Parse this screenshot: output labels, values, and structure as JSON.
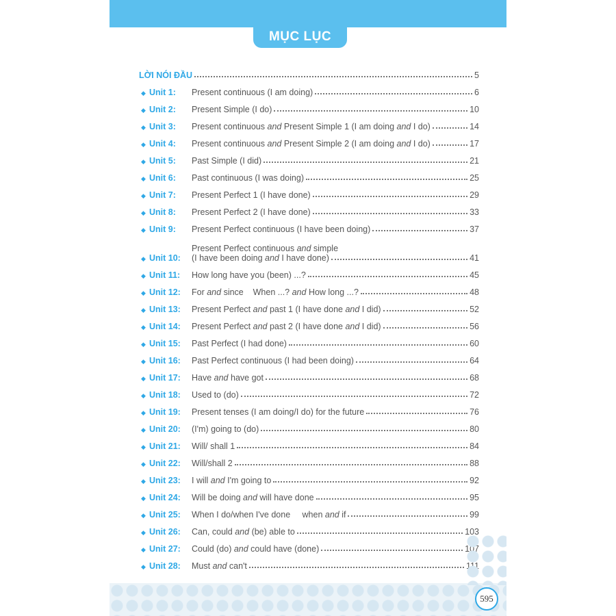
{
  "header": {
    "title": "MỤC LỤC"
  },
  "intro": {
    "label": "LỜI NÓI ĐẦU",
    "page": "5"
  },
  "units": [
    {
      "label": "Unit 1:",
      "title": "Present continuous (I am doing)",
      "page": "6"
    },
    {
      "label": "Unit 2:",
      "title": "Present Simple (I do)",
      "page": "10"
    },
    {
      "label": "Unit 3:",
      "title": "Present continuous and Present Simple 1 (I am doing and I do)",
      "page": "14"
    },
    {
      "label": "Unit 4:",
      "title": "Present continuous and Present Simple 2 (I am doing and I do)",
      "page": "17"
    },
    {
      "label": "Unit 5:",
      "title": "Past Simple (I did)",
      "page": "21"
    },
    {
      "label": "Unit 6:",
      "title": "Past continuous (I was doing)",
      "page": "25"
    },
    {
      "label": "Unit 7:",
      "title": "Present Perfect 1 (I have done)",
      "page": "29"
    },
    {
      "label": "Unit 8:",
      "title": "Present Perfect 2 (I have done)",
      "page": "33"
    },
    {
      "label": "Unit 9:",
      "title": "Present Perfect continuous (I have been doing)",
      "page": "37"
    },
    {
      "label": "Unit 10:",
      "title": "Present Perfect continuous and simple",
      "title_line2": "(I have been doing and I have done)",
      "page": "41"
    },
    {
      "label": "Unit 11:",
      "title": "How long have you (been) ...?",
      "page": "45"
    },
    {
      "label": "Unit 12:",
      "title": "For and since    When ...? and How long ...?",
      "page": "48"
    },
    {
      "label": "Unit 13:",
      "title": "Present Perfect and past 1 (I have done and I did)",
      "page": "52"
    },
    {
      "label": "Unit 14:",
      "title": "Present Perfect and past 2 (I have done and I did)",
      "page": "56"
    },
    {
      "label": "Unit 15:",
      "title": "Past Perfect (I had done)",
      "page": "60"
    },
    {
      "label": "Unit 16:",
      "title": "Past Perfect continuous (I had been doing)",
      "page": "64"
    },
    {
      "label": "Unit 17:",
      "title": "Have and have got",
      "page": "68"
    },
    {
      "label": "Unit 18:",
      "title": "Used to (do)",
      "page": "72"
    },
    {
      "label": "Unit 19:",
      "title": "Present tenses (I am doing/I do) for the future",
      "page": "76"
    },
    {
      "label": "Unit 20:",
      "title": "(I'm) going to (do)",
      "page": "80"
    },
    {
      "label": "Unit 21:",
      "title": "Will/ shall 1",
      "page": "84"
    },
    {
      "label": "Unit 22:",
      "title": "Will/shall 2",
      "page": "88"
    },
    {
      "label": "Unit 23:",
      "title": "I will and I'm going to",
      "page": "92"
    },
    {
      "label": "Unit 24:",
      "title": "Will be doing and will have done",
      "page": "95"
    },
    {
      "label": "Unit 25:",
      "title": "When I do/when I've done     when and if",
      "page": "99"
    },
    {
      "label": "Unit 26:",
      "title": "Can, could and (be) able to",
      "page": "103"
    },
    {
      "label": "Unit 27:",
      "title": "Could (do) and could have (done)",
      "page": "107"
    },
    {
      "label": "Unit 28:",
      "title": "Must and can't",
      "page": "111"
    }
  ],
  "footer": {
    "page_number": "595"
  },
  "colors": {
    "accent": "#2fa8e6",
    "band": "#5bbfee",
    "text": "#555555"
  }
}
